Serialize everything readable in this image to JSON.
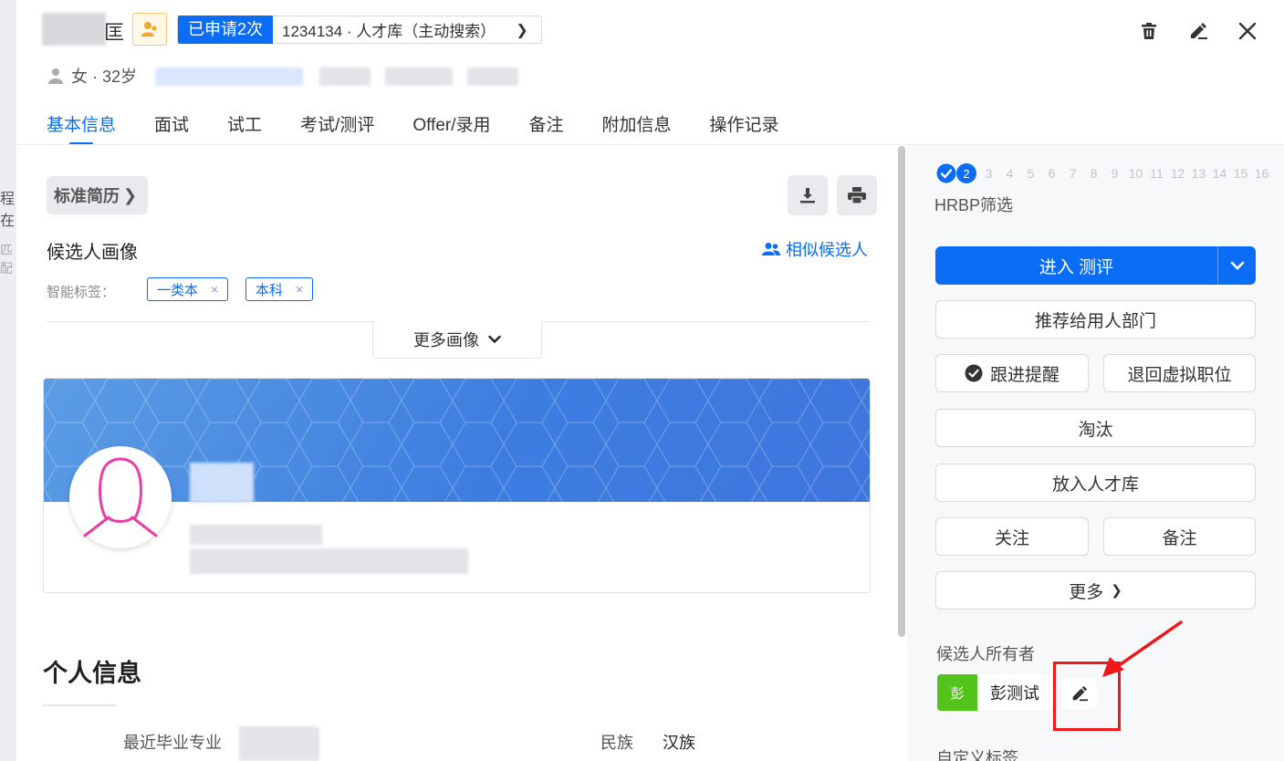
{
  "background": {
    "fragment_1": "程在",
    "fragment_2": "匹配"
  },
  "header": {
    "name_fragment": "匡",
    "apply_badge": "已申请2次",
    "apply_text": "1234134 · 人才库（主动搜索）",
    "apply_chevron": "❯",
    "gender_age": "女 · 32岁"
  },
  "tabs": [
    {
      "label": "基本信息",
      "active": true
    },
    {
      "label": "面试"
    },
    {
      "label": "试工"
    },
    {
      "label": "考试/测评"
    },
    {
      "label": "Offer/录用"
    },
    {
      "label": "备注"
    },
    {
      "label": "附加信息"
    },
    {
      "label": "操作记录"
    }
  ],
  "resume": {
    "standard_resume": "标准简历",
    "chevron": "❯"
  },
  "portrait": {
    "title": "候选人画像",
    "similar": "相似候选人",
    "smart_tags_label": "智能标签：",
    "tags": [
      "一类本",
      "本科"
    ],
    "tag_remove": "×",
    "more": "更多画像"
  },
  "personal": {
    "title": "个人信息",
    "field1_label": "最近毕业专业",
    "field2_label": "民族",
    "field2_value": "汉族"
  },
  "pipeline": {
    "steps": [
      "3",
      "4",
      "5",
      "6",
      "7",
      "8",
      "9",
      "10",
      "11",
      "12",
      "13",
      "14",
      "15",
      "16"
    ],
    "current_step": "2",
    "stage_label": "HRBP筛选"
  },
  "actions": {
    "enter_assessment": "进入 测评",
    "recommend": "推荐给用人部门",
    "follow_up": "跟进提醒",
    "return_virtual": "退回虚拟职位",
    "eliminate": "淘汰",
    "talent_pool": "放入人才库",
    "watch": "关注",
    "note": "备注",
    "more": "更多",
    "more_chevron": "❯"
  },
  "owner": {
    "label": "候选人所有者",
    "avatar_text": "彭",
    "name": "彭测试"
  },
  "custom_tags_label": "自定义标签",
  "colors": {
    "primary": "#0b6cf5",
    "owner_avatar": "#52c41a",
    "annotation": "#f0161a",
    "badge_bg": "#fff8e6"
  },
  "icons": {
    "delete": "trash-icon",
    "edit": "pencil-icon",
    "close": "close-icon",
    "download": "download-icon",
    "print": "printer-icon",
    "user": "user-icon",
    "users": "users-icon",
    "check": "check-circle-icon",
    "dropdown": "chevron-down-icon"
  }
}
